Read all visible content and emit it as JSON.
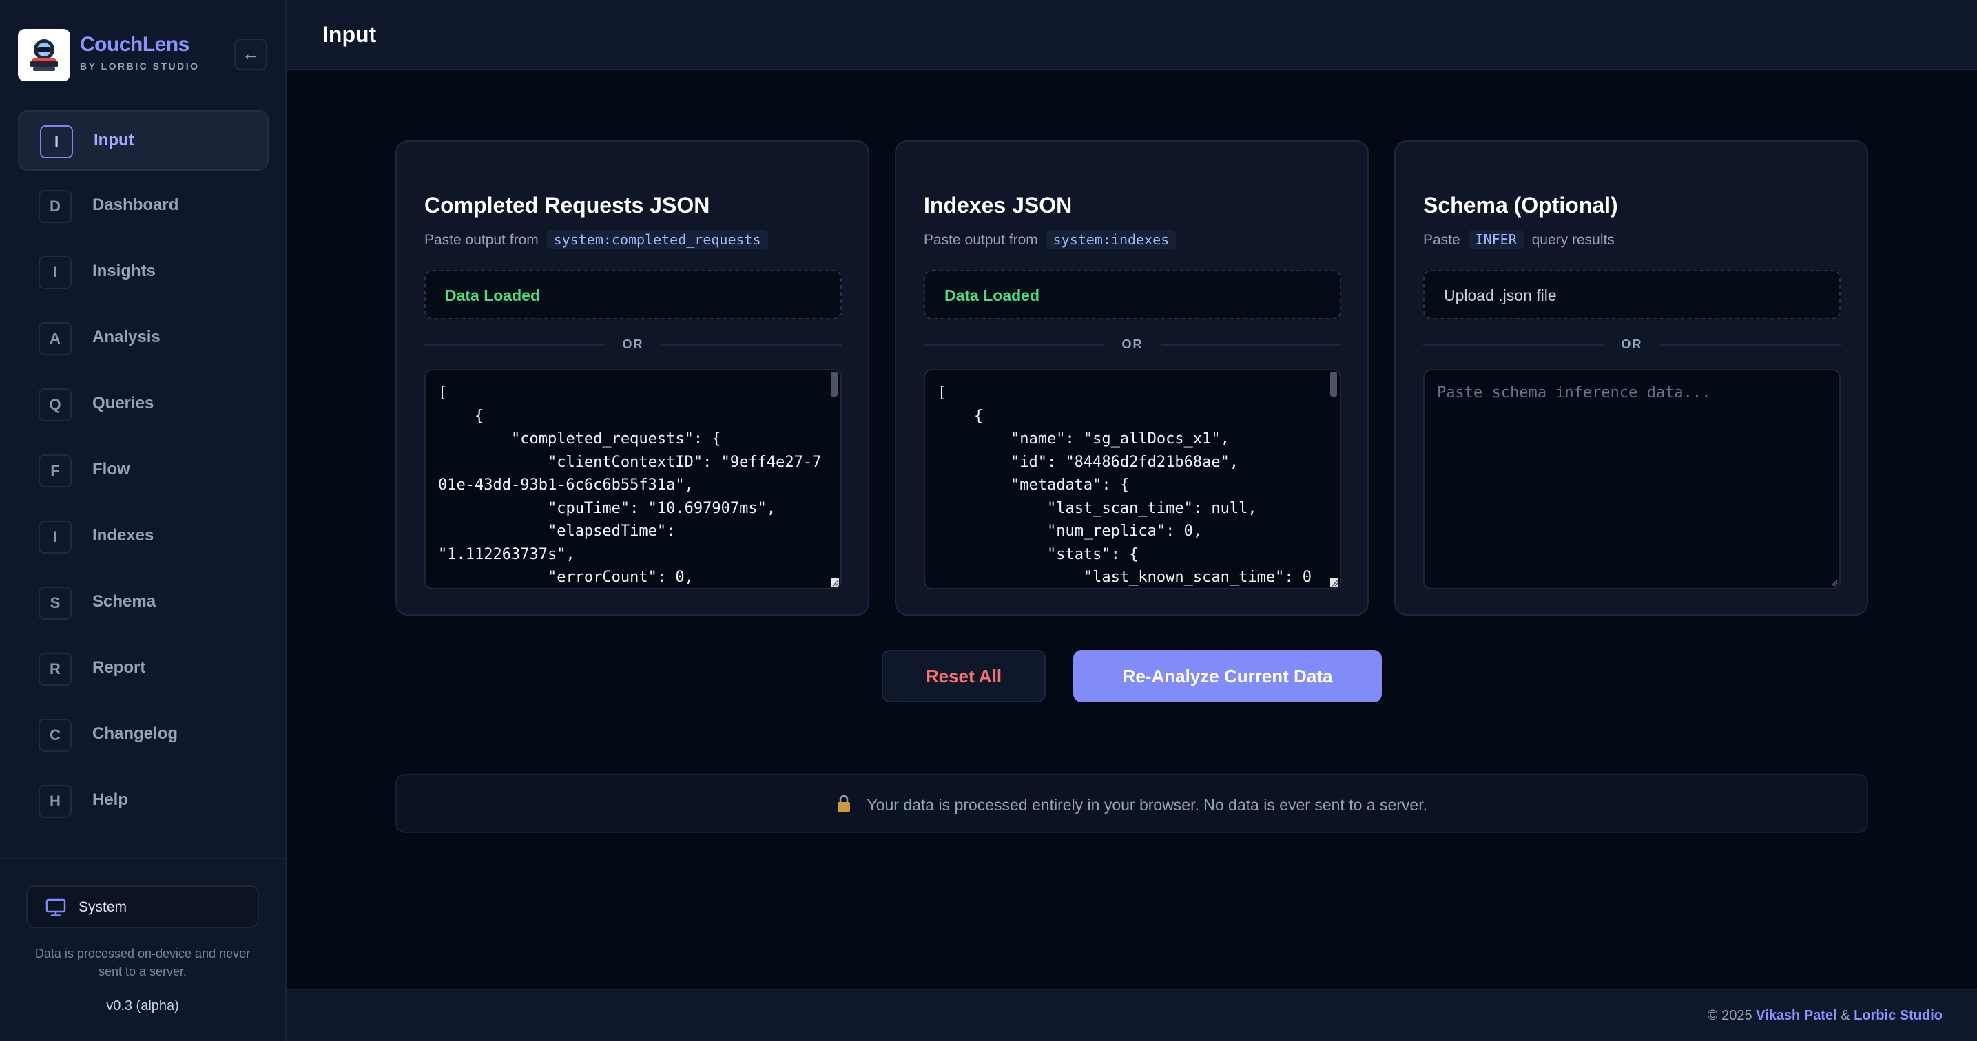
{
  "brand": {
    "name": "CouchLens",
    "subtitle": "BY LORBIC STUDIO",
    "collapse_icon": "arrow-left-icon"
  },
  "sidebar": {
    "items": [
      {
        "badge": "I",
        "label": "Input",
        "active": true
      },
      {
        "badge": "D",
        "label": "Dashboard"
      },
      {
        "badge": "I",
        "label": "Insights"
      },
      {
        "badge": "A",
        "label": "Analysis"
      },
      {
        "badge": "Q",
        "label": "Queries"
      },
      {
        "badge": "F",
        "label": "Flow"
      },
      {
        "badge": "I",
        "label": "Indexes"
      },
      {
        "badge": "S",
        "label": "Schema"
      },
      {
        "badge": "R",
        "label": "Report"
      },
      {
        "badge": "C",
        "label": "Changelog"
      },
      {
        "badge": "H",
        "label": "Help"
      }
    ],
    "theme": {
      "label": "System",
      "icon": "monitor-icon"
    },
    "note": "Data is processed on-device and never sent to a server.",
    "version": "v0.3 (alpha)"
  },
  "header": {
    "title": "Input"
  },
  "cards": [
    {
      "title": "Completed Requests JSON",
      "sub_before": "Paste output from",
      "sub_code": "system:completed_requests",
      "sub_after": "",
      "drop_label": "Data Loaded",
      "or": "OR",
      "textarea_value": "[\n    {\n        \"completed_requests\": {\n            \"clientContextID\": \"9eff4e27-701e-43dd-93b1-6c6c6b55f31a\",\n            \"cpuTime\": \"10.697907ms\",\n            \"elapsedTime\":\n\"1.112263737s\",\n            \"errorCount\": 0,",
      "placeholder": ""
    },
    {
      "title": "Indexes JSON",
      "sub_before": "Paste output from",
      "sub_code": "system:indexes",
      "sub_after": "",
      "drop_label": "Data Loaded",
      "or": "OR",
      "textarea_value": "[\n    {\n        \"name\": \"sg_allDocs_x1\",\n        \"id\": \"84486d2fd21b68ae\",\n        \"metadata\": {\n            \"last_scan_time\": null,\n            \"num_replica\": 0,\n            \"stats\": {\n                \"last_known_scan_time\": 0",
      "placeholder": ""
    },
    {
      "title": "Schema (Optional)",
      "sub_before": "Paste",
      "sub_code": "INFER",
      "sub_after": "query results",
      "drop_label": "Upload .json file",
      "or": "OR",
      "textarea_value": "",
      "placeholder": "Paste schema inference data..."
    }
  ],
  "actions": {
    "reset": "Reset All",
    "analyze": "Re-Analyze Current Data"
  },
  "privacy": {
    "icon": "lock-icon",
    "text": "Your data is processed entirely in your browser. No data is ever sent to a server."
  },
  "footer": {
    "copyright": "© 2025",
    "author": "Vikash Patel",
    "amp": "&",
    "studio": "Lorbic Studio"
  },
  "colors": {
    "accent": "#818cf8",
    "success": "#4ade80",
    "danger": "#f87171",
    "background": "#040916",
    "panel": "#0f172a"
  }
}
